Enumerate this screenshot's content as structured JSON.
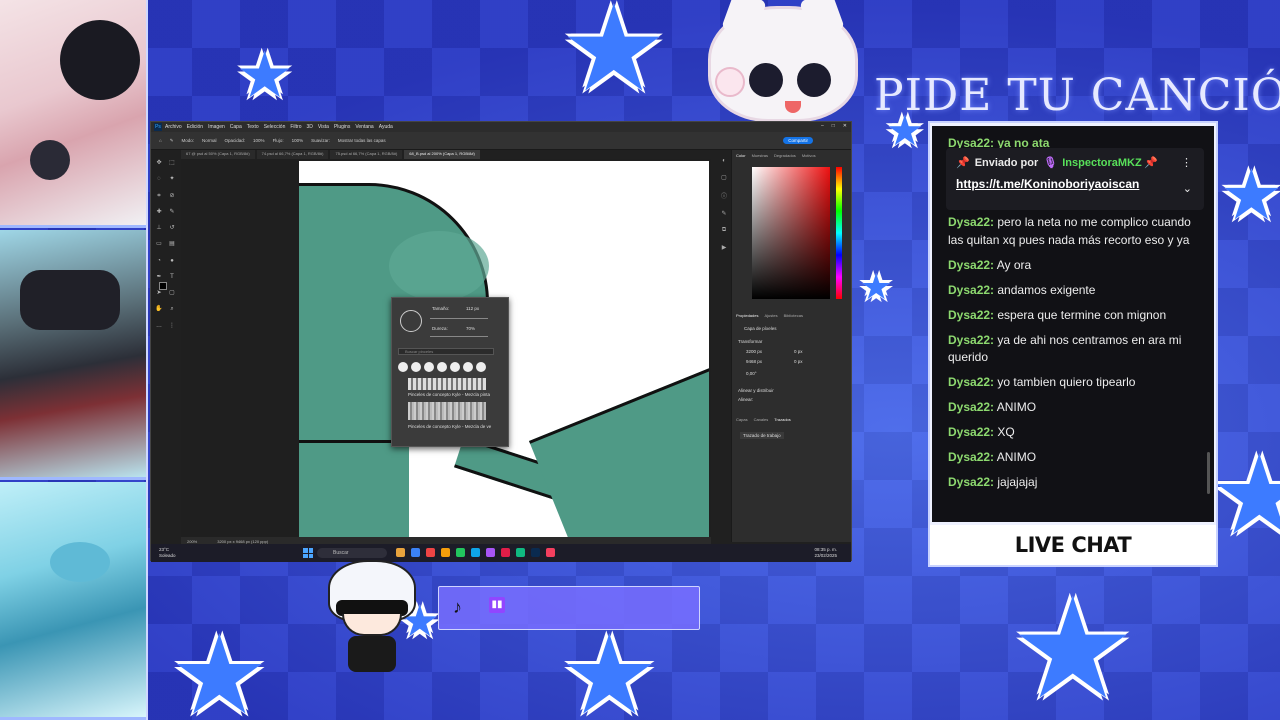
{
  "overlay": {
    "title": "PIDE TU CANCIÓN",
    "live_chat_label": "LIVE CHAT"
  },
  "photoshop": {
    "menu": [
      "Archivo",
      "Edición",
      "Imagen",
      "Capa",
      "Texto",
      "Selección",
      "Filtro",
      "3D",
      "Vista",
      "Plugins",
      "Ventana",
      "Ayuda"
    ],
    "options": [
      "Modo:",
      "Normal",
      "Opacidad:",
      "100%",
      "Flujo:",
      "100%",
      "Suavizar:",
      "Mostrar todas las capas"
    ],
    "share_label": "Compartir",
    "tabs": [
      "67 @ psd al 50% (Capa 1, RGB/8#)",
      "74.psd al 66,7% (Capa 1, RGB/8#)",
      "75.psd al 66,7% (Capa 1, RGB/8#)",
      "68_B.psd al 200% (Capa 1, RGB/8#)"
    ],
    "status": [
      "200%",
      "3200 px x 9468 px (120 ppp)"
    ],
    "brush_popup": {
      "size_label": "Tamaño:",
      "size_value": "112 px",
      "hardness_label": "Dureza:",
      "hardness_value": "70%",
      "search_placeholder": "Buscar pinceles",
      "preset1": "Pinceles de concepto Kyle - Mezcla pinta",
      "preset2": "Pinceles de concepto Kyle - Mezcla de ve"
    },
    "panels": {
      "color_tabs": [
        "Color",
        "Muestras",
        "Degradados",
        "Motivos"
      ],
      "prop_tabs": [
        "Propiedades",
        "Ajustes",
        "Bibliotecas"
      ],
      "layer_type": "Capa de píxeles",
      "transform_label": "Transformar",
      "w": "3200 px",
      "h": "9468 px",
      "angle": "0,00°",
      "x": "0 px",
      "y": "0 px",
      "align_label": "Alinear y distribuir",
      "align_sub": "Alinear:",
      "layers_tabs": [
        "Capas",
        "Canales",
        "Trazados"
      ],
      "path_item": "Trazado de trabajo"
    },
    "taskbar": {
      "weather_temp": "23°C",
      "weather_desc": "Soleado",
      "search": "Buscar",
      "time": "08:35 p. m.",
      "date": "23/02/2025"
    }
  },
  "chat": {
    "cut_message": "Dysa22: ya no ata",
    "pinned": {
      "sent_by": "Enviado por",
      "user": "InspectoraMKZ",
      "link": "https://t.me/Koninoboriyaoiscan"
    },
    "messages": [
      {
        "user": "Dysa22:",
        "text": "pero la neta no me complico cuando las quitan xq pues nada más recorto eso y ya"
      },
      {
        "user": "Dysa22:",
        "text": "Ay ora"
      },
      {
        "user": "Dysa22:",
        "text": "andamos exigente"
      },
      {
        "user": "Dysa22:",
        "text": "espera que termine con mignon"
      },
      {
        "user": "Dysa22:",
        "text": "ya de ahi nos centramos en ara mi querido"
      },
      {
        "user": "Dysa22:",
        "text": "yo tambien quiero tipearlo"
      },
      {
        "user": "Dysa22:",
        "text": "ANIMO"
      },
      {
        "user": "Dysa22:",
        "text": "XQ"
      },
      {
        "user": "Dysa22:",
        "text": "ANIMO"
      },
      {
        "user": "Dysa22:",
        "text": "jajajajaj"
      }
    ]
  },
  "colors": {
    "chat_user": "#8dd96f",
    "pinned_user": "#58e05a",
    "twitch": "#9146ff"
  },
  "icons": [
    "tiktok-icon",
    "twitch-icon",
    "pin-icon",
    "more-icon",
    "chevron-down-icon"
  ]
}
